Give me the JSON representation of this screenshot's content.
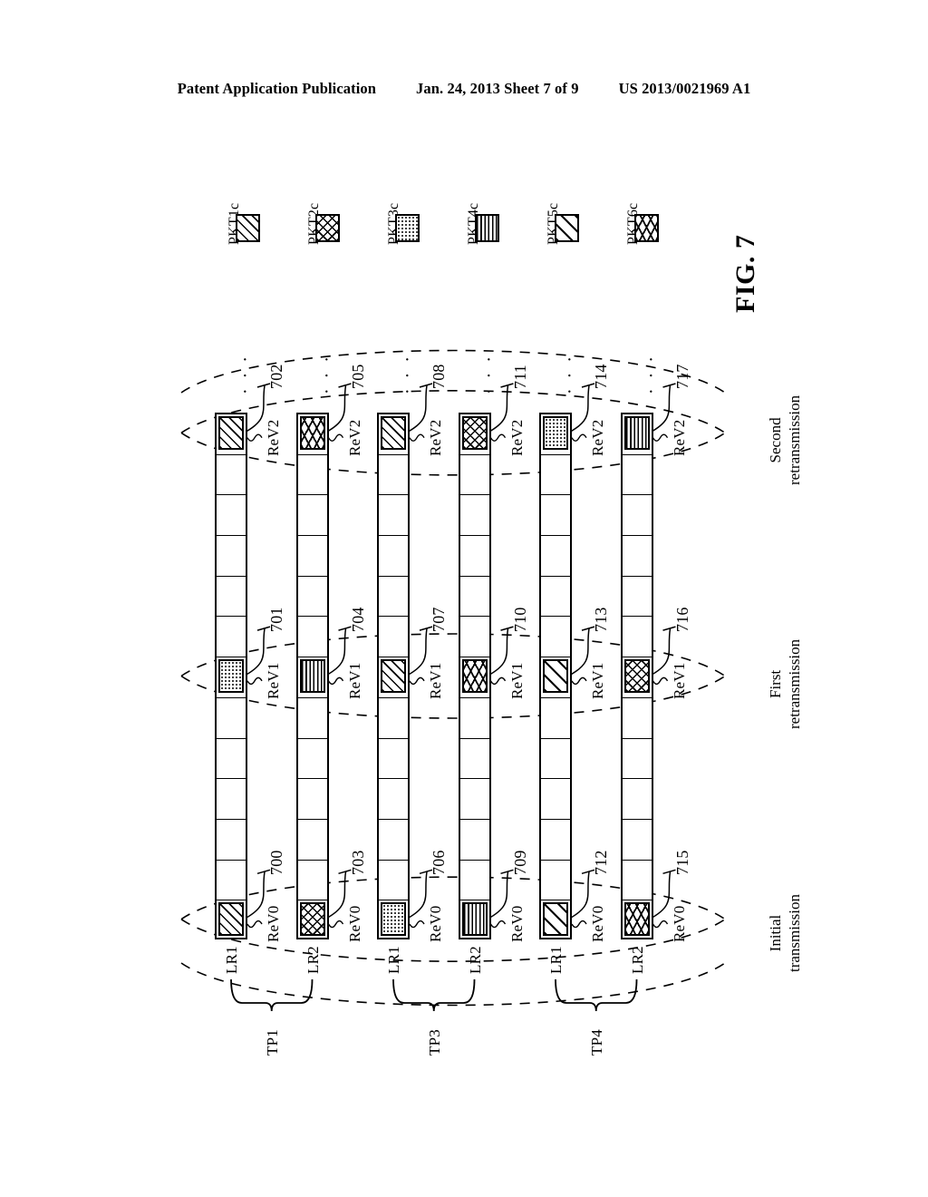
{
  "header": {
    "publication": "Patent Application Publication",
    "date_sheet": "Jan. 24, 2013  Sheet 7 of 9",
    "patent_number": "US 2013/0021969 A1"
  },
  "figure": {
    "label": "FIG. 7"
  },
  "legend": {
    "items": [
      {
        "label": "PKT1c",
        "pattern": "diag-dense"
      },
      {
        "label": "PKT2c",
        "pattern": "cross-hatch"
      },
      {
        "label": "PKT3c",
        "pattern": "dots"
      },
      {
        "label": "PKT4c",
        "pattern": "vlines"
      },
      {
        "label": "PKT5c",
        "pattern": "diag-sparse"
      },
      {
        "label": "PKT6c",
        "pattern": "cross-diag"
      }
    ]
  },
  "diagram": {
    "stages": [
      {
        "line1": "Initial",
        "line2": "transmission"
      },
      {
        "line1": "First",
        "line2": "retransmission"
      },
      {
        "line1": "Second",
        "line2": "retransmission"
      }
    ],
    "rev_labels": [
      "ReV0",
      "ReV1",
      "ReV2"
    ],
    "cells_per_lane": 13,
    "ellipsis": "· · ·",
    "groups": [
      {
        "tp": "TP1",
        "lanes": [
          "LR1",
          "LR2"
        ]
      },
      {
        "tp": "TP3",
        "lanes": [
          "LR1",
          "LR2"
        ]
      },
      {
        "tp": "TP4",
        "lanes": [
          "LR1",
          "LR2"
        ]
      }
    ],
    "lanes": [
      {
        "group": "TP1",
        "link": "LR1",
        "packets": [
          {
            "stage": 0,
            "ref": "700",
            "pattern": "diag-dense",
            "rev": "ReV0"
          },
          {
            "stage": 1,
            "ref": "701",
            "pattern": "dots",
            "rev": "ReV1"
          },
          {
            "stage": 2,
            "ref": "702",
            "pattern": "diag-dense",
            "rev": "ReV2"
          }
        ]
      },
      {
        "group": "TP1",
        "link": "LR2",
        "packets": [
          {
            "stage": 0,
            "ref": "703",
            "pattern": "cross-hatch",
            "rev": "ReV0"
          },
          {
            "stage": 1,
            "ref": "704",
            "pattern": "vlines",
            "rev": "ReV1"
          },
          {
            "stage": 2,
            "ref": "705",
            "pattern": "cross-diag",
            "rev": "ReV2"
          }
        ]
      },
      {
        "group": "TP3",
        "link": "LR1",
        "packets": [
          {
            "stage": 0,
            "ref": "706",
            "pattern": "dots",
            "rev": "ReV0"
          },
          {
            "stage": 1,
            "ref": "707",
            "pattern": "diag-dense",
            "rev": "ReV1"
          },
          {
            "stage": 2,
            "ref": "708",
            "pattern": "diag-dense",
            "rev": "ReV2"
          }
        ]
      },
      {
        "group": "TP3",
        "link": "LR2",
        "packets": [
          {
            "stage": 0,
            "ref": "709",
            "pattern": "vlines",
            "rev": "ReV0"
          },
          {
            "stage": 1,
            "ref": "710",
            "pattern": "cross-diag",
            "rev": "ReV1"
          },
          {
            "stage": 2,
            "ref": "711",
            "pattern": "cross-hatch",
            "rev": "ReV2"
          }
        ]
      },
      {
        "group": "TP4",
        "link": "LR1",
        "packets": [
          {
            "stage": 0,
            "ref": "712",
            "pattern": "diag-sparse",
            "rev": "ReV0"
          },
          {
            "stage": 1,
            "ref": "713",
            "pattern": "diag-sparse",
            "rev": "ReV1"
          },
          {
            "stage": 2,
            "ref": "714",
            "pattern": "dots",
            "rev": "ReV2"
          }
        ]
      },
      {
        "group": "TP4",
        "link": "LR2",
        "packets": [
          {
            "stage": 0,
            "ref": "715",
            "pattern": "cross-diag",
            "rev": "ReV0"
          },
          {
            "stage": 1,
            "ref": "716",
            "pattern": "cross-hatch",
            "rev": "ReV1"
          },
          {
            "stage": 2,
            "ref": "717",
            "pattern": "vlines",
            "rev": "ReV2"
          }
        ]
      }
    ]
  }
}
